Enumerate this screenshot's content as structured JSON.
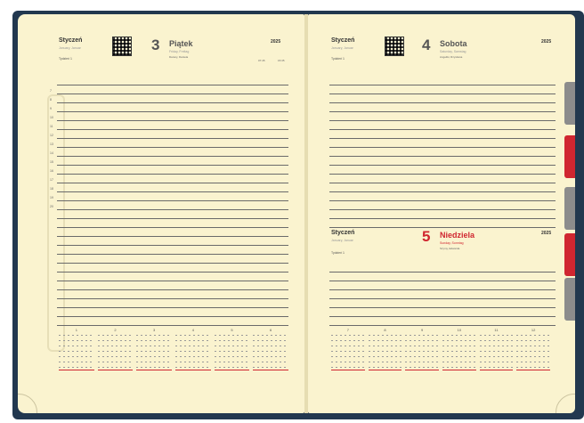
{
  "left_page": {
    "month": "Styczeń",
    "month_sub": "January, Januar",
    "day_number": "3",
    "day_name": "Piątek",
    "day_sub": "Friday, Freitag",
    "name_day": "Danuty, Daniela",
    "year": "2025",
    "week": "Tydzień 1",
    "sun_info": "07:45",
    "sun_info2": "15:35",
    "hours": [
      "",
      "7",
      "8",
      "9",
      "10",
      "11",
      "12",
      "13",
      "14",
      "15",
      "16",
      "17",
      "18",
      "19",
      "20",
      "",
      "",
      "",
      ""
    ],
    "mini_months": [
      "1",
      "2",
      "3",
      "4",
      "5",
      "6"
    ]
  },
  "right_page": {
    "top": {
      "month": "Styczeń",
      "month_sub": "January, Januar",
      "day_number": "4",
      "day_name": "Sobota",
      "day_sub": "Saturday, Samstag",
      "name_day": "Angeliki, Rzystiana",
      "year": "2025",
      "week": "Tydzień 1"
    },
    "bottom": {
      "month": "Styczeń",
      "month_sub": "January, Januar",
      "day_number": "5",
      "day_name": "Niedziela",
      "day_sub": "Sunday, Sonntag",
      "name_day": "Szymy, Edwarda",
      "year": "2025",
      "week": "Tydzień 1"
    },
    "mini_months": [
      "7",
      "8",
      "9",
      "10",
      "11",
      "12"
    ]
  },
  "colors": {
    "cover": "#22384f",
    "paper": "#faf3cf",
    "accent_red": "#d02630",
    "tab_gray": "#8c8c8c"
  }
}
